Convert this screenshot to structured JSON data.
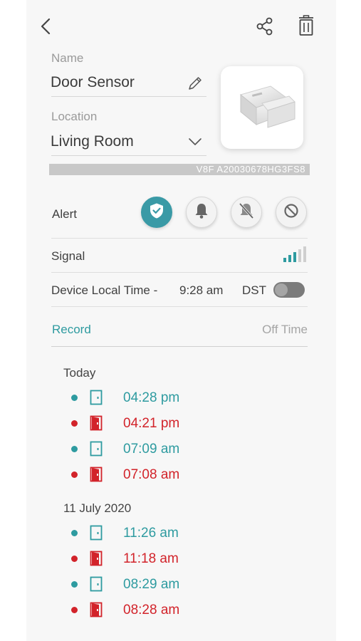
{
  "header": {
    "back_icon": "chevron-left-icon",
    "share_icon": "share-icon",
    "delete_icon": "trash-icon"
  },
  "device": {
    "name_label": "Name",
    "name_value": "Door Sensor",
    "edit_icon": "pencil-icon",
    "location_label": "Location",
    "location_value": "Living Room",
    "dropdown_icon": "chevron-down-icon",
    "serial": "V8F  A20030678HG3FS8",
    "image": "door-sensor-image"
  },
  "alert": {
    "label": "Alert",
    "modes": [
      {
        "name": "shield-check-icon",
        "active": true
      },
      {
        "name": "bell-icon",
        "active": false
      },
      {
        "name": "mute-icon",
        "active": false
      },
      {
        "name": "disabled-icon",
        "active": false
      }
    ]
  },
  "signal": {
    "label": "Signal",
    "icon": "signal-bars-icon",
    "level": 3,
    "max": 5
  },
  "device_time": {
    "label": "Device Local Time -",
    "time": "9:28 am",
    "dst_label": "DST",
    "dst_on": false
  },
  "record": {
    "title": "Record",
    "filter": "Off Time"
  },
  "records": [
    {
      "date": "Today",
      "entries": [
        {
          "time": "04:28 pm",
          "state": "closed"
        },
        {
          "time": "04:21 pm",
          "state": "open"
        },
        {
          "time": "07:09 am",
          "state": "closed"
        },
        {
          "time": "07:08 am",
          "state": "open"
        }
      ]
    },
    {
      "date": "11 July 2020",
      "entries": [
        {
          "time": "11:26 am",
          "state": "closed"
        },
        {
          "time": "11:18 am",
          "state": "open"
        },
        {
          "time": "08:29 am",
          "state": "closed"
        },
        {
          "time": "08:28 am",
          "state": "open"
        }
      ]
    }
  ],
  "colors": {
    "accent": "#2e9ba0",
    "alert_active": "#3a9aa6",
    "open": "#d2232a",
    "closed": "#2e9ba0"
  }
}
